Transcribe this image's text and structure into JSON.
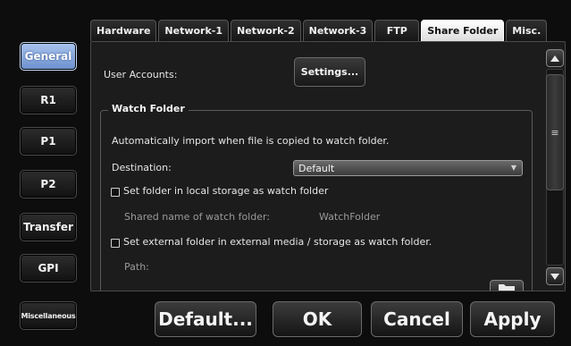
{
  "sidebar": {
    "items": [
      {
        "label": "General",
        "active": true
      },
      {
        "label": "R1"
      },
      {
        "label": "P1"
      },
      {
        "label": "P2"
      },
      {
        "label": "Transfer"
      },
      {
        "label": "GPI"
      },
      {
        "label": "Miscellaneous"
      }
    ]
  },
  "tabs": [
    "Hardware",
    "Network-1",
    "Network-2",
    "Network-3",
    "FTP",
    "Share Folder",
    "Misc."
  ],
  "active_tab": "Share Folder",
  "content": {
    "user_accounts_label": "User Accounts:",
    "settings_button": "Settings...",
    "watch_folder": {
      "title": "Watch Folder",
      "description": "Automatically import when file is copied to watch folder.",
      "destination_label": "Destination:",
      "destination_value": "Default",
      "local_checkbox_label": "Set folder in local storage as watch folder",
      "local_checkbox_checked": false,
      "shared_name_label": "Shared name of watch folder:",
      "shared_name_value": "WatchFolder",
      "external_checkbox_label": "Set external folder in external media / storage as watch folder.",
      "external_checkbox_checked": false,
      "path_label": "Path:"
    }
  },
  "icons": {
    "scroll_up": "triangle-up-icon",
    "scroll_down": "triangle-down-icon",
    "scroll_grip": "grip-lines-icon",
    "dropdown_arrow": "chevron-down-icon",
    "browse_folder": "folder-icon"
  },
  "footer": {
    "default_button": "Default...",
    "ok_button": "OK",
    "cancel_button": "Cancel",
    "apply_button": "Apply"
  },
  "colors": {
    "active_nav": "#8fb0e6",
    "background": "#0d0d0d",
    "panel": "#1c1c1c"
  }
}
